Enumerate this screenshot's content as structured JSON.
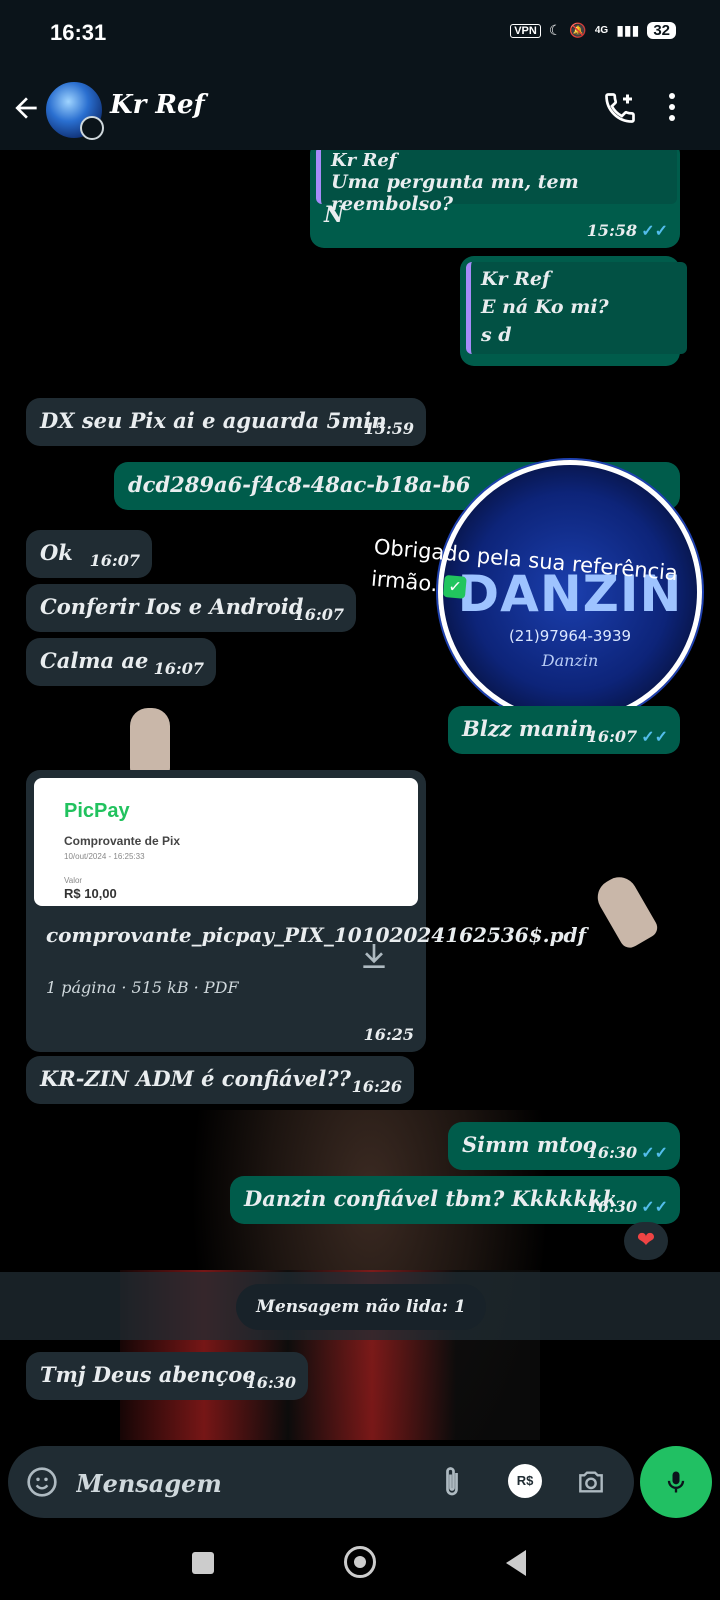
{
  "status_bar": {
    "time": "16:31",
    "vpn": "VPN",
    "network": "4G",
    "battery": "32"
  },
  "header": {
    "title": "Kr Ref"
  },
  "messages": [
    {
      "quote_author": "Kr Ref",
      "quote_text": "Uma pergunta mn, tem reembolso?",
      "text": "N",
      "time": "15:58"
    },
    {
      "quote_author": "Kr Ref",
      "quote_text": "E ná Ko mi?",
      "quote_extra": "s d"
    },
    {
      "text": "DX seu Pix ai e aguarda 5min",
      "time": "15:59"
    },
    {
      "text": "dcd289a6-f4c8-48ac-b18a-b6"
    },
    {
      "text": "Ok",
      "time": "16:07"
    },
    {
      "text": "Conferir Ios e Android",
      "time": "16:07"
    },
    {
      "text": "Calma ae",
      "time": "16:07"
    },
    {
      "text": "Blzz manin",
      "time": "16:07"
    },
    {
      "text": "KR-ZIN ADM é confiável??",
      "time": "16:26"
    },
    {
      "text": "Simm mtoo",
      "time": "16:30"
    },
    {
      "text": "Danzin confiável tbm? Kkkkkkk",
      "time": "16:30"
    },
    {
      "text": "Tmj Deus abençoe",
      "time": "16:30"
    }
  ],
  "sticker": {
    "name": "DANZIN",
    "phone": "(21)97964-3939",
    "signature": "Danzin",
    "caption": "Obrigado pela sua referência irmão."
  },
  "document": {
    "preview_brand": "PicPay",
    "preview_title": "Comprovante de Pix",
    "preview_date": "10/out/2024 - 16:25:33",
    "preview_value_label": "Valor",
    "preview_value": "R$ 10,00",
    "filename": "comprovante_picpay_PIX_10102024162536$.pdf",
    "meta": "1 página · 515 kB · PDF",
    "time": "16:25"
  },
  "reaction": "❤",
  "unread_label": "Mensagem não lida: 1",
  "input": {
    "placeholder": "Mensagem",
    "pay_label": "R$"
  },
  "colors": {
    "incoming": "#202c33",
    "outgoing": "#005c4b",
    "accent": "#21c063",
    "read_ticks": "#53bdeb"
  }
}
